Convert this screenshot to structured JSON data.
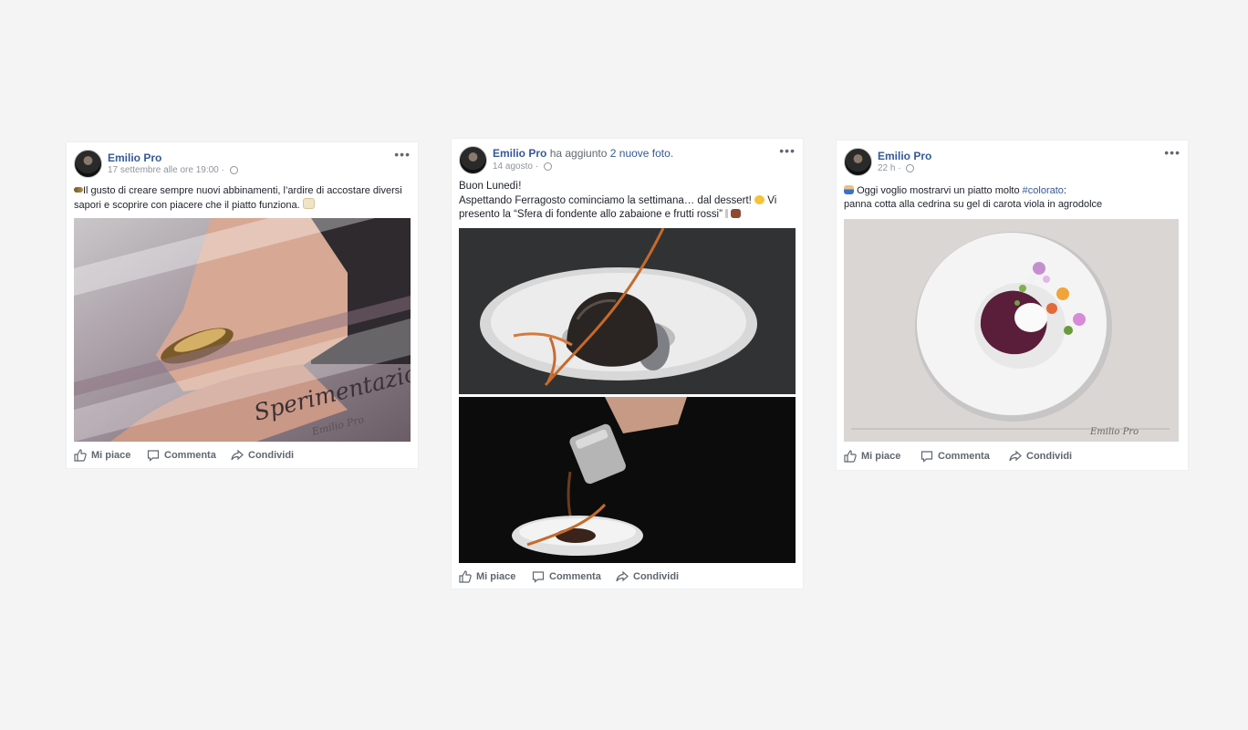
{
  "posts": [
    {
      "author": "Emilio Pro",
      "timestamp": "17 settembre alle ore 19:00",
      "text_line1": "Il gusto di creare sempre nuovi abbinamenti, l’ardire di accostare diversi",
      "text_line2": "sapori e scoprire con piacere che il piatto funziona.",
      "image": {
        "overlay_title": "Sperimentazione",
        "signature": "Emilio Pro"
      }
    },
    {
      "author": "Emilio Pro",
      "action": "ha aggiunto",
      "action_link": "2 nuove foto",
      "timestamp": "14 agosto",
      "text_line1": "Buon Lunedì!",
      "text_line2": "Aspettando Ferragosto cominciamo la settimana… dal dessert!",
      "text_line2_tail": "Vi",
      "text_line3": "presento la “Sfera di fondente allo zabaione e frutti rossi”"
    },
    {
      "author": "Emilio Pro",
      "timestamp": "22 h",
      "text_line1": "Oggi voglio mostrarvi un piatto molto",
      "hashtag": "#colorato",
      "text_line1_end": ":",
      "text_line2": "panna cotta alla cedrina su gel di carota viola in agrodolce",
      "image": {
        "signature": "Emilio Pro"
      }
    }
  ],
  "actions": {
    "like": "Mi piace",
    "comment": "Commenta",
    "share": "Condividi"
  },
  "ui": {
    "options_glyph": "•••",
    "separator": "·",
    "like_icon": "thumbs-up-icon",
    "comment_icon": "speech-bubble-icon",
    "share_icon": "share-arrow-icon"
  },
  "colors": {
    "author_link": "#365899",
    "meta_text": "#90949c",
    "action_text": "#606770",
    "background": "#f4f4f4"
  }
}
